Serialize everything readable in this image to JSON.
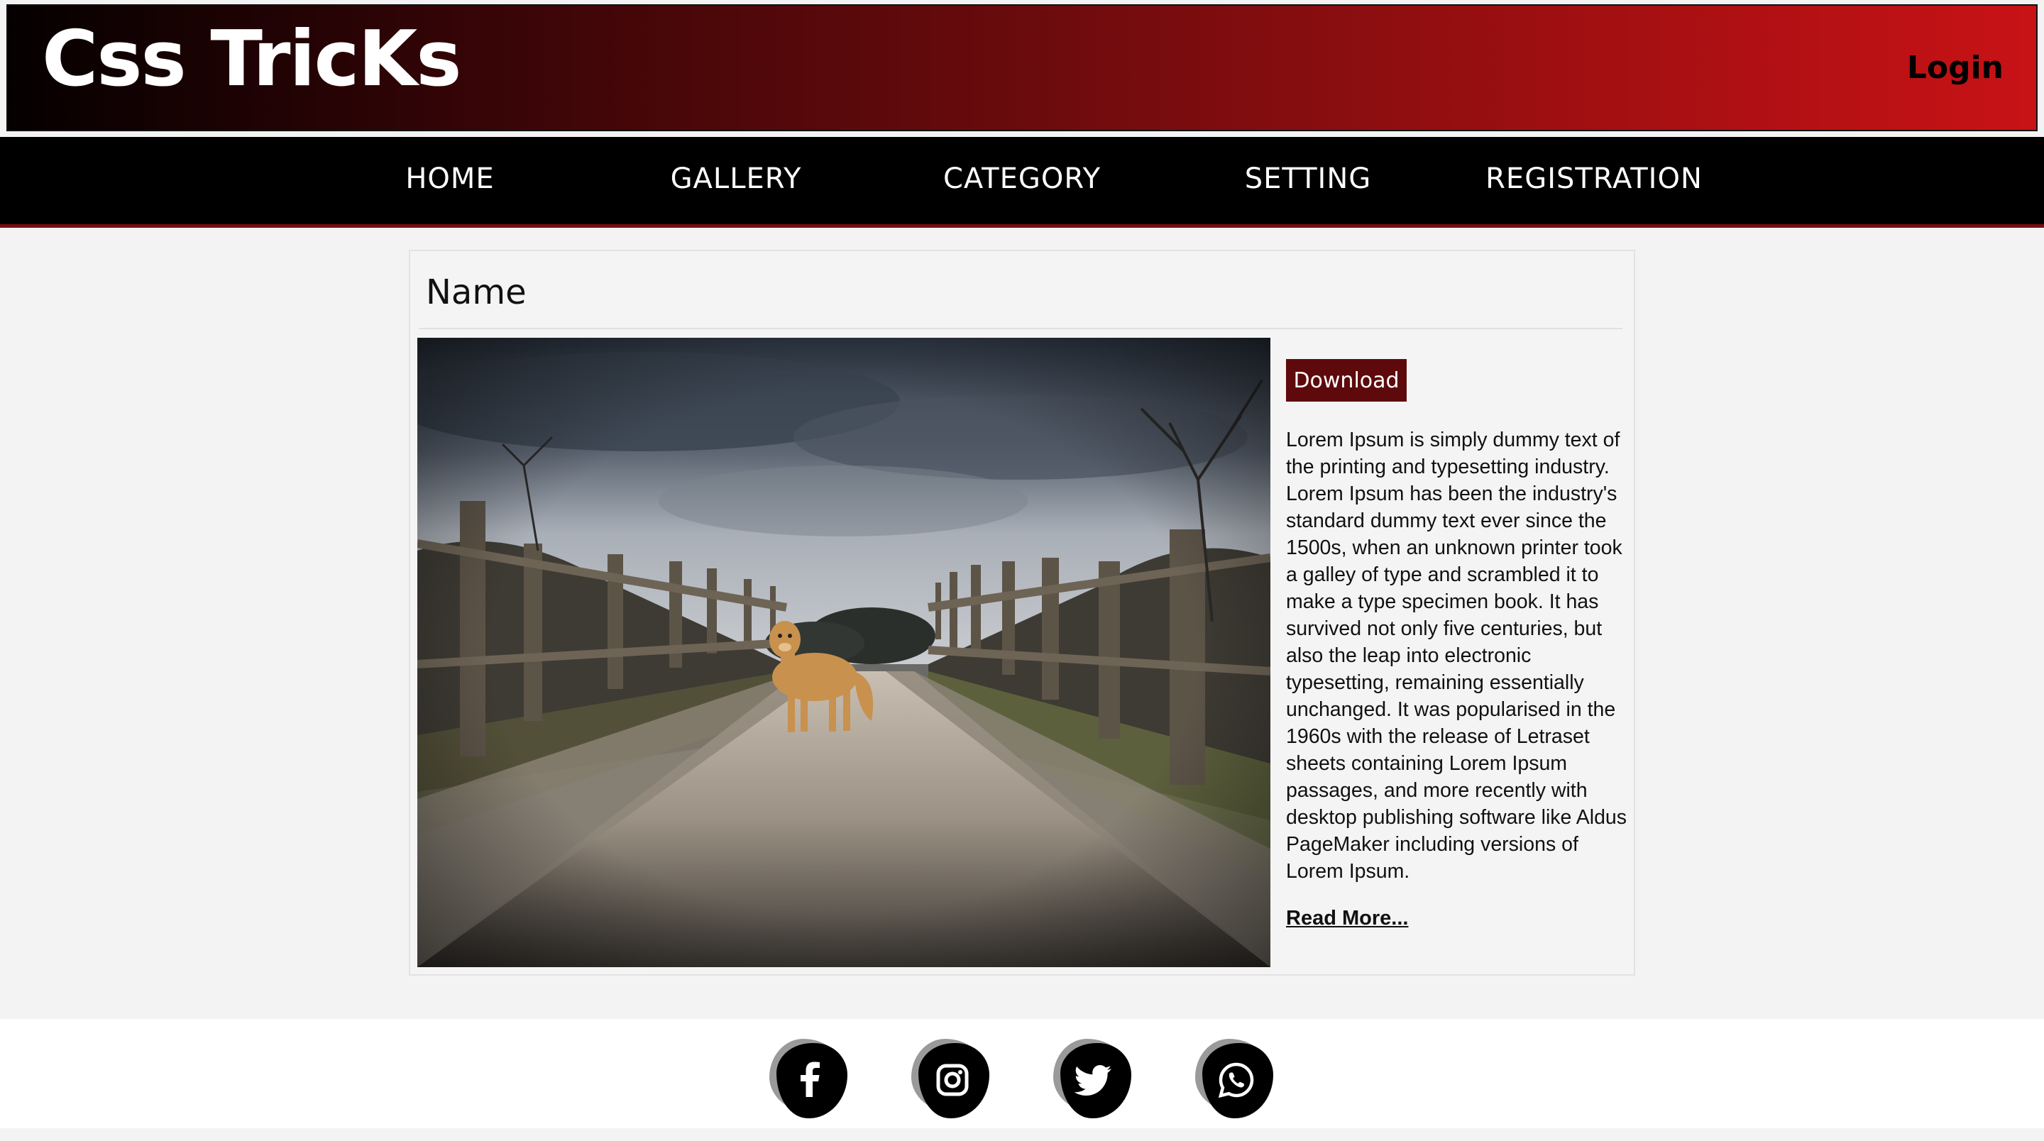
{
  "header": {
    "logo": "Css TricKs",
    "login_label": "Login"
  },
  "nav": {
    "items": [
      {
        "label": "HOME"
      },
      {
        "label": "GALLERY"
      },
      {
        "label": "CATEGORY"
      },
      {
        "label": "SETTING"
      },
      {
        "label": "REGISTRATION"
      }
    ]
  },
  "card": {
    "title": "Name",
    "download_label": "Download",
    "description": "Lorem Ipsum is simply dummy text of the printing and typesetting industry. Lorem Ipsum has been the industry's standard dummy text ever since the 1500s, when an unknown printer took a galley of type and scrambled it to make a type specimen book. It has survived not only five centuries, but also the leap into electronic typesetting, remaining essentially unchanged. It was popularised in the 1960s with the release of Letraset sheets containing Lorem Ipsum passages, and more recently with desktop publishing software like Aldus PageMaker including versions of Lorem Ipsum.",
    "read_more_label": "Read More...",
    "image_subject": "golden-retriever-on-sandy-path-between-wooden-fences"
  },
  "footer": {
    "social_icons": [
      "facebook-icon",
      "instagram-icon",
      "twitter-icon",
      "whatsapp-icon"
    ]
  },
  "colors": {
    "header_gradient_start": "#050000",
    "header_gradient_end": "#c81216",
    "nav_background": "#000000",
    "nav_accent": "#7a0c10",
    "button_background": "#5e0a0d",
    "page_background": "#f3f3f3"
  }
}
